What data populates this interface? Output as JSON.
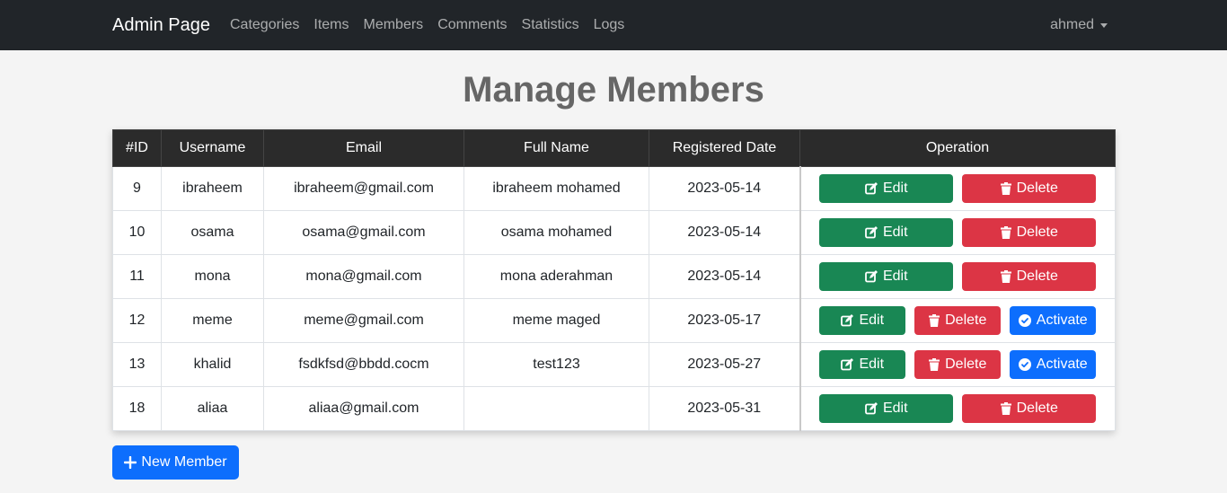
{
  "navbar": {
    "brand": "Admin Page",
    "links": [
      "Categories",
      "Items",
      "Members",
      "Comments",
      "Statistics",
      "Logs"
    ],
    "user": "ahmed"
  },
  "page": {
    "title": "Manage Members"
  },
  "table": {
    "headers": [
      "#ID",
      "Username",
      "Email",
      "Full Name",
      "Registered Date",
      "Operation"
    ],
    "rows": [
      {
        "id": "9",
        "username": "ibraheem",
        "email": "ibraheem@gmail.com",
        "fullname": "ibraheem mohamed",
        "date": "2023-05-14",
        "activate": false
      },
      {
        "id": "10",
        "username": "osama",
        "email": "osama@gmail.com",
        "fullname": "osama mohamed",
        "date": "2023-05-14",
        "activate": false
      },
      {
        "id": "11",
        "username": "mona",
        "email": "mona@gmail.com",
        "fullname": "mona aderahman",
        "date": "2023-05-14",
        "activate": false
      },
      {
        "id": "12",
        "username": "meme",
        "email": "meme@gmail.com",
        "fullname": "meme maged",
        "date": "2023-05-17",
        "activate": true
      },
      {
        "id": "13",
        "username": "khalid",
        "email": "fsdkfsd@bbdd.cocm",
        "fullname": "test123",
        "date": "2023-05-27",
        "activate": true
      },
      {
        "id": "18",
        "username": "aliaa",
        "email": "aliaa@gmail.com",
        "fullname": "",
        "date": "2023-05-31",
        "activate": false
      }
    ],
    "labels": {
      "edit": "Edit",
      "delete": "Delete",
      "activate": "Activate"
    }
  },
  "actions": {
    "new_member": "New Member"
  },
  "colors": {
    "edit": "#198754",
    "delete": "#dc3545",
    "activate": "#0d6efd",
    "navbar": "#212529"
  }
}
